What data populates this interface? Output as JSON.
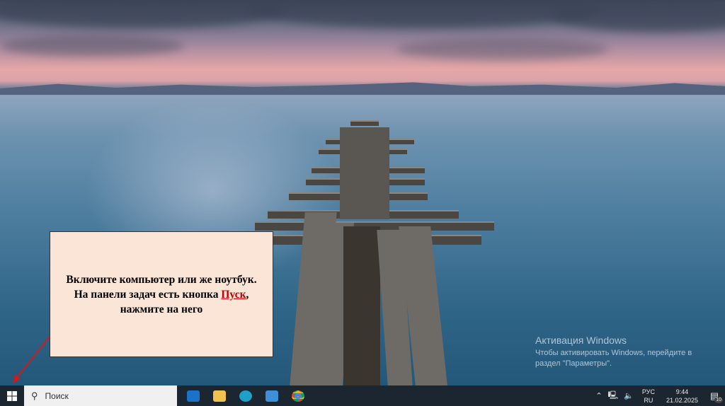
{
  "callout": {
    "text_before": "Включите компьютер или же ноутбук. На панели задач есть кнопка ",
    "link": "Пуск",
    "text_after": ", нажмите на него"
  },
  "activation": {
    "title": "Активация Windows",
    "desc": "Чтобы активировать Windows, перейдите в раздел \"Параметры\"."
  },
  "taskbar": {
    "search_placeholder": "Поиск",
    "apps": [
      {
        "name": "outlook",
        "color": "#1a73c8"
      },
      {
        "name": "file-explorer",
        "color": "#f2c14e"
      },
      {
        "name": "edge",
        "color": "#1da1c8"
      },
      {
        "name": "mail",
        "color": "#3d8fd6"
      },
      {
        "name": "chrome",
        "color": "#db4437"
      }
    ],
    "tray": {
      "lang_top": "РУС",
      "lang_bottom": "RU",
      "time": "9:44",
      "date": "21.02.2025",
      "notifications": "10"
    }
  },
  "colors": {
    "accent_red": "#c00000",
    "arrow": "#d11a1a"
  }
}
